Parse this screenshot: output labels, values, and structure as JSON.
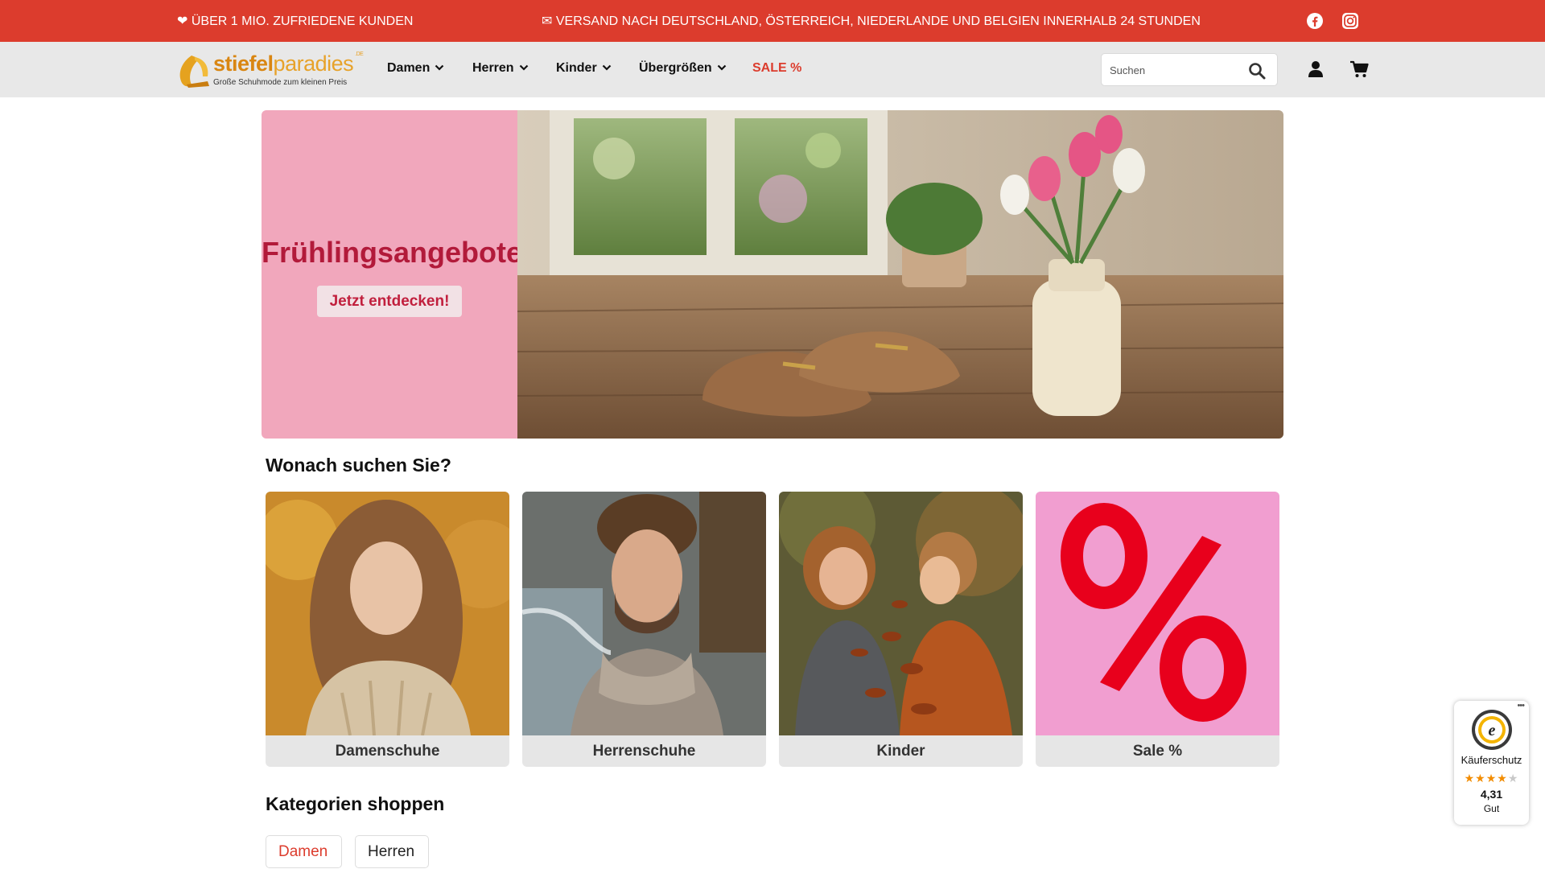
{
  "topbar": {
    "left_text": "❤ ÜBER 1 MIO. ZUFRIEDENE KUNDEN",
    "center_text": "✉ VERSAND NACH DEUTSCHLAND, ÖSTERREICH, NIEDERLANDE UND BELGIEN INNERHALB 24 STUNDEN",
    "social_icons": [
      "facebook-icon",
      "instagram-icon"
    ],
    "bg_color": "#dc3c2d"
  },
  "header": {
    "logo": {
      "word_bold": "stiefel",
      "word_regular": "paradies",
      "suffix": ".DE",
      "tagline": "Große Schuhmode zum kleinen Preis"
    },
    "nav": [
      {
        "label": "Damen",
        "has_dropdown": true
      },
      {
        "label": "Herren",
        "has_dropdown": true
      },
      {
        "label": "Kinder",
        "has_dropdown": true
      },
      {
        "label": "Übergrößen",
        "has_dropdown": true
      },
      {
        "label": "SALE %",
        "has_dropdown": false
      }
    ],
    "search": {
      "placeholder": "Suchen",
      "value": ""
    },
    "icons": [
      "user-icon",
      "cart-icon"
    ]
  },
  "hero": {
    "title": "Frühlingsangebote",
    "button_label": "Jetzt entdecken!",
    "panel_color": "#f1a7bc",
    "title_color": "#b21a3a"
  },
  "section_categories": {
    "heading": "Wonach suchen Sie?",
    "cards": [
      {
        "label": "Damenschuhe"
      },
      {
        "label": "Herrenschuhe"
      },
      {
        "label": "Kinder"
      },
      {
        "label": "Sale %"
      }
    ]
  },
  "section_shop": {
    "heading": "Kategorien shoppen",
    "tabs": [
      {
        "label": "Damen",
        "active": true
      },
      {
        "label": "Herren",
        "active": false
      }
    ]
  },
  "trusted_shops": {
    "label": "Käuferschutz",
    "rating": 4.31,
    "score_text": "4,31",
    "grade": "Gut",
    "stars_filled": 4,
    "stars_total": 5
  },
  "accent_color": "#dc3c2d"
}
